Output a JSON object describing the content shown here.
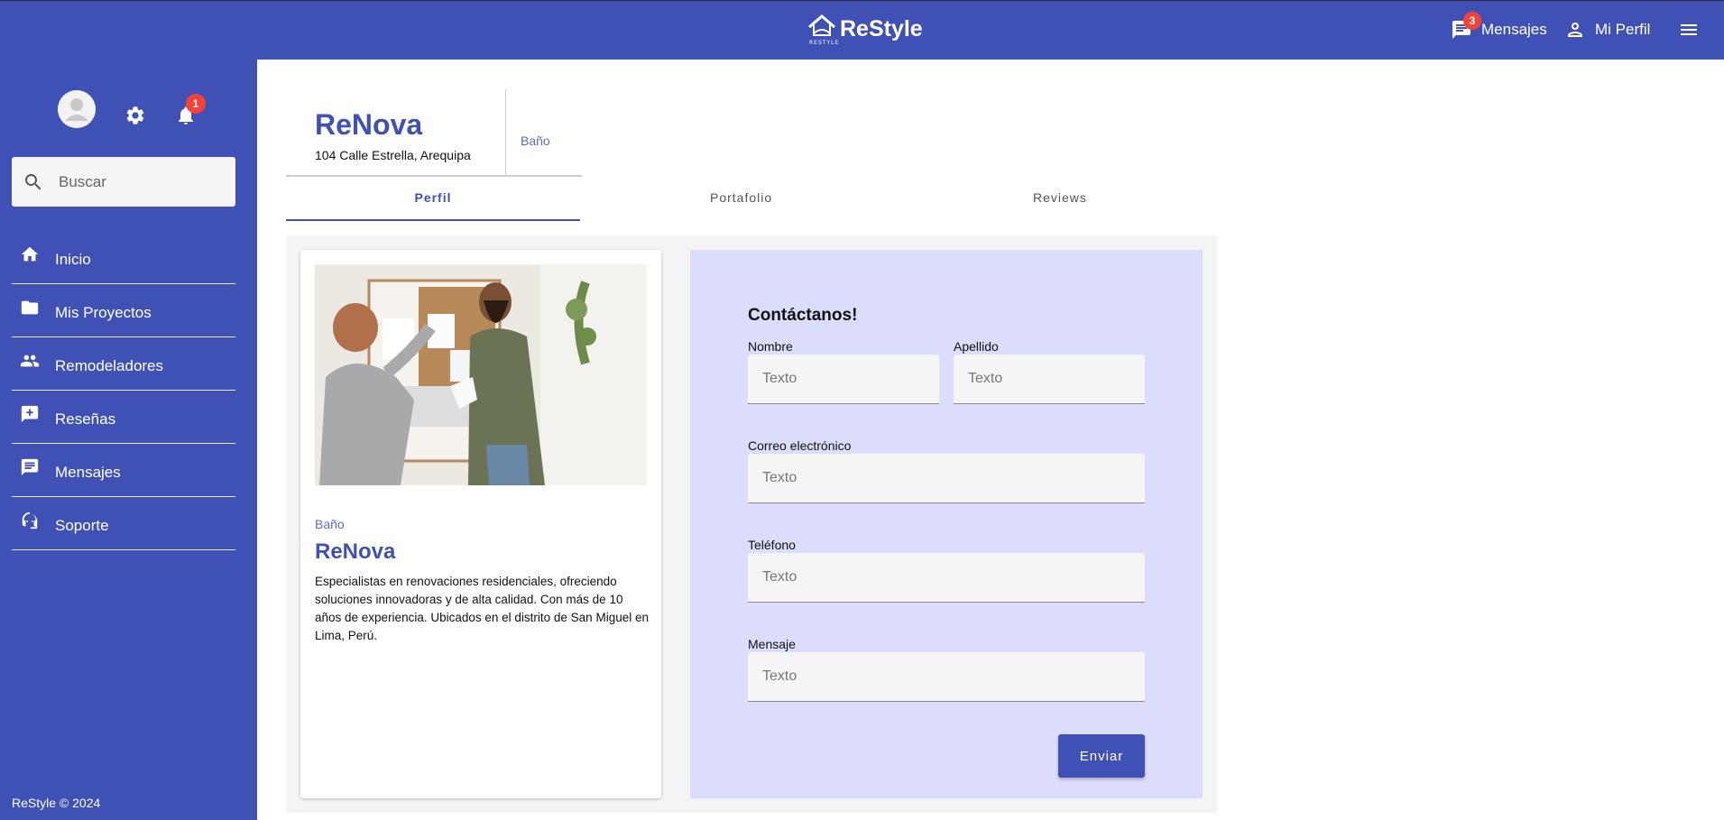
{
  "topbar": {
    "app_name": "ReStyle",
    "logo_sub": "RESTYLE",
    "messages_label": "Mensajes",
    "messages_badge": "3",
    "profile_label": "Mi Perfil"
  },
  "sidebar": {
    "notifications_badge": "1",
    "search_placeholder": "Buscar",
    "items": [
      {
        "label": "Inicio",
        "icon": "home-icon"
      },
      {
        "label": "Mis Proyectos",
        "icon": "folder-icon"
      },
      {
        "label": "Remodeladores",
        "icon": "people-icon"
      },
      {
        "label": "Reseñas",
        "icon": "rate-review-icon"
      },
      {
        "label": "Mensajes",
        "icon": "chat-icon"
      },
      {
        "label": "Soporte",
        "icon": "support-agent-icon"
      }
    ],
    "footer": "ReStyle © 2024"
  },
  "business": {
    "name": "ReNova",
    "address": "104 Calle Estrella, Arequipa",
    "category": "Baño"
  },
  "tabs": [
    "Perfil",
    "Portafolio",
    "Reviews"
  ],
  "card": {
    "category": "Baño",
    "title": "ReNova",
    "description": "Especialistas en renovaciones residenciales, ofreciendo soluciones innovadoras y de alta calidad. Con más de 10 años de experiencia. Ubicados en el distrito de San Miguel en Lima, Perú."
  },
  "form": {
    "title": "Contáctanos!",
    "nombre_label": "Nombre",
    "apellido_label": "Apellido",
    "correo_label": "Correo electrónico",
    "telefono_label": "Teléfono",
    "mensaje_label": "Mensaje",
    "placeholder": "Texto",
    "submit_label": "Enviar"
  },
  "colors": {
    "primary": "#3f51b5",
    "badge": "#f44336",
    "form_bg": "#dcdcfc"
  }
}
